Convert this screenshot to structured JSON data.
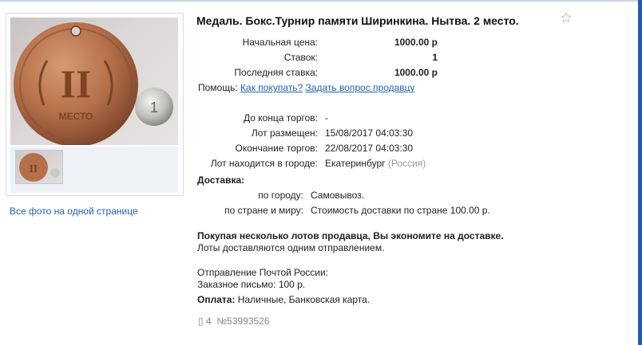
{
  "lot": {
    "title": "Медаль. Бокс.Турнир памяти Ширинкина. Нытва. 2 место.",
    "start_price_label": "Начальная цена:",
    "start_price": "1000.00 р",
    "bids_label": "Ставок:",
    "bids": "1",
    "last_bid_label": "Последняя ставка:",
    "last_bid": "1000.00 р",
    "help_label": "Помощь:",
    "help_link_1": "Как покупать?",
    "help_link_2": "Задать вопрос продавцу",
    "time_left_label": "До конца торгов:",
    "time_left": "-",
    "posted_label": "Лот размещен:",
    "posted": "15/08/2017 04:03:30",
    "end_label": "Окончание торгов:",
    "end": "22/08/2017 04:03:30",
    "city_label": "Лот находится в городе:",
    "city": "Екатеринбург",
    "country": "(Россия)"
  },
  "delivery": {
    "heading": "Доставка:",
    "city_label": "по городу:",
    "city_value": "Самовывоз.",
    "country_label": "по стране и миру:",
    "country_value": "Стоимость доставки по стране 100.00 р.",
    "combine_bold": "Покупая несколько лотов продавца, Вы экономите на доставке.",
    "combine_note": "Лоты доставляются одним отправлением.",
    "post_line1": "Отправление Почтой России:",
    "post_line2": "Заказное письмо: 100 р.",
    "payment_label": "Оплата:",
    "payment_value": "Наличные, Банковская карта."
  },
  "footer": {
    "views": "4",
    "lot_number": "№53993526"
  },
  "gallery": {
    "all_photos": "Все фото на одной странице",
    "medal_text_roman": "II",
    "medal_text_word": "МЕСТО"
  },
  "colors": {
    "link": "#2362b0",
    "accent_strip": "#1f5fb0",
    "medal": "#b4704a"
  }
}
